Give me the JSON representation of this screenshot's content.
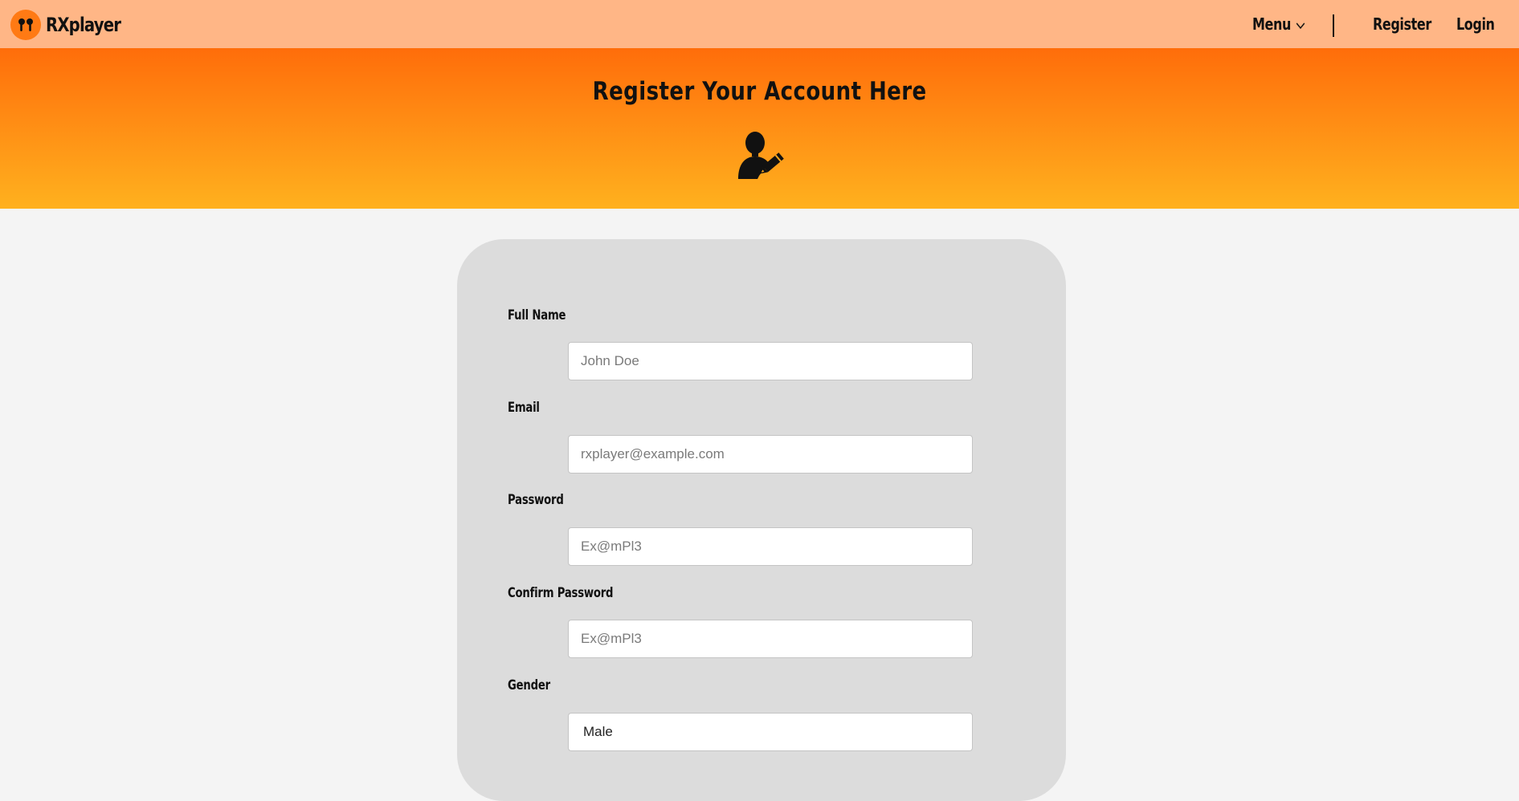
{
  "brand": {
    "name": "RXplayer",
    "logo_icon": "earbuds-icon"
  },
  "nav": {
    "menu_label": "Menu",
    "register_label": "Register",
    "login_label": "Login"
  },
  "hero": {
    "title": "Register Your Account Here",
    "icon": "user-edit-icon"
  },
  "form": {
    "full_name": {
      "label": "Full Name",
      "placeholder": "John Doe"
    },
    "email": {
      "label": "Email",
      "placeholder": "rxplayer@example.com"
    },
    "password": {
      "label": "Password",
      "placeholder": "Ex@mPl3"
    },
    "confirm_password": {
      "label": "Confirm Password",
      "placeholder": "Ex@mPl3"
    },
    "gender": {
      "label": "Gender",
      "selected": "Male"
    }
  },
  "colors": {
    "navbar": "#ffb686",
    "hero_top": "#ff6d0a",
    "hero_bottom": "#ffb11e",
    "card": "#dcdcdc",
    "logo": "#ff7a14"
  }
}
